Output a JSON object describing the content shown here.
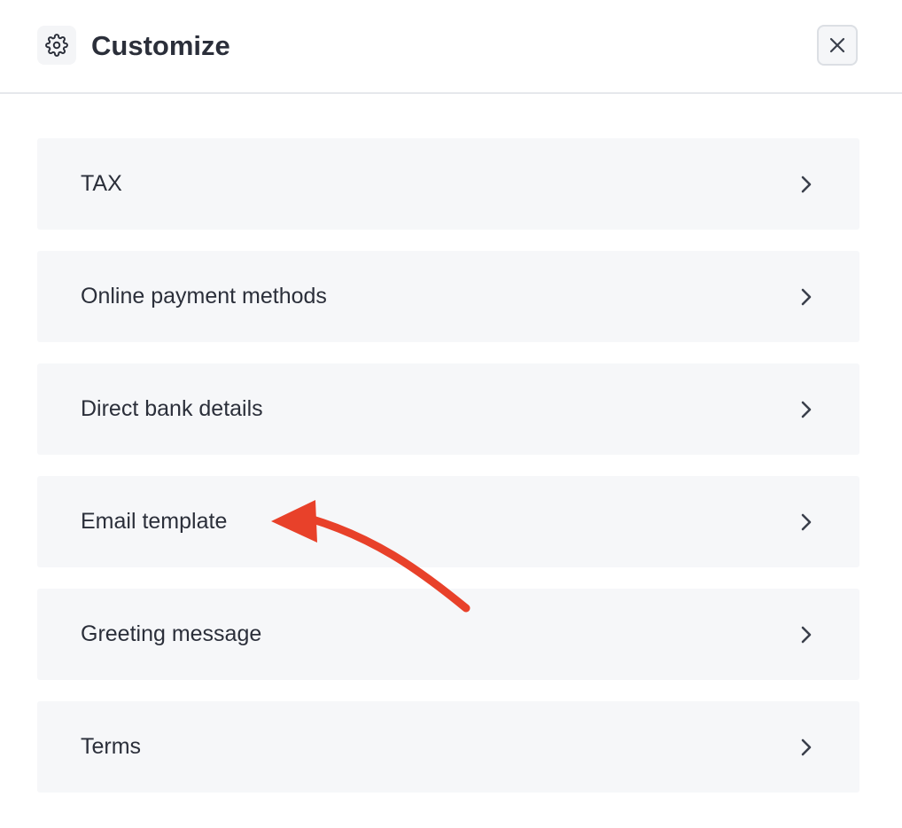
{
  "header": {
    "title": "Customize",
    "icon": "gear-icon",
    "close_icon": "close-icon"
  },
  "items": [
    {
      "label": "TAX"
    },
    {
      "label": "Online payment methods"
    },
    {
      "label": "Direct bank details"
    },
    {
      "label": "Email template"
    },
    {
      "label": "Greeting message"
    },
    {
      "label": "Terms"
    }
  ],
  "colors": {
    "annotation_arrow": "#e8412a",
    "row_background": "#f6f7f9",
    "text": "#2b2f3a"
  }
}
